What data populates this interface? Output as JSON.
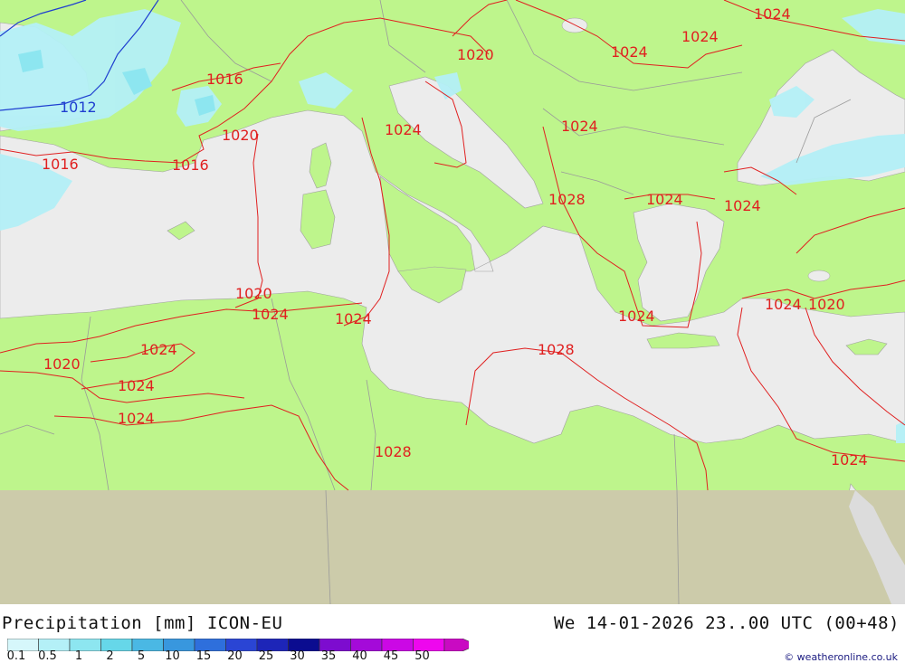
{
  "title": {
    "left": "Precipitation [mm] ICON-EU",
    "right": "We 14-01-2026 23..00 UTC (00+48)"
  },
  "credit": "© weatheronline.co.uk",
  "legend": {
    "colors": [
      "#d6f7fb",
      "#b4f0f7",
      "#8de6f0",
      "#66d7e9",
      "#4ab8e4",
      "#3897de",
      "#2e6fdc",
      "#2a45d4",
      "#1d25b8",
      "#0b0c90",
      "#7d0ccf",
      "#a40ad9",
      "#cb08e5",
      "#ee07ee",
      "#c90ac2"
    ],
    "ticks": [
      "0.1",
      "0.5",
      "1",
      "2",
      "5",
      "10",
      "15",
      "20",
      "25",
      "30",
      "35",
      "40",
      "45",
      "50"
    ]
  },
  "map": {
    "colors": {
      "sea": "#ececec",
      "land": "#bef58c",
      "outside_domain": "#cccbaa",
      "isobar_red": "#e02020",
      "isobar_blue": "#1f3fd0",
      "precip": "#b4f0f7",
      "border": "#9a9a9a"
    },
    "isobar_labels": [
      {
        "text": "1012",
        "color": "blue"
      },
      {
        "text": "1016"
      },
      {
        "text": "1016"
      },
      {
        "text": "1016"
      },
      {
        "text": "1020"
      },
      {
        "text": "1020"
      },
      {
        "text": "1020"
      },
      {
        "text": "1020"
      },
      {
        "text": "1020"
      },
      {
        "text": "1024"
      },
      {
        "text": "1024"
      },
      {
        "text": "1024"
      },
      {
        "text": "1024"
      },
      {
        "text": "1024"
      },
      {
        "text": "1024"
      },
      {
        "text": "1024"
      },
      {
        "text": "1024"
      },
      {
        "text": "1024"
      },
      {
        "text": "1024"
      },
      {
        "text": "1024"
      },
      {
        "text": "1024"
      },
      {
        "text": "1024"
      },
      {
        "text": "1024"
      },
      {
        "text": "1024"
      },
      {
        "text": "1028"
      },
      {
        "text": "1028"
      },
      {
        "text": "1028"
      }
    ]
  }
}
